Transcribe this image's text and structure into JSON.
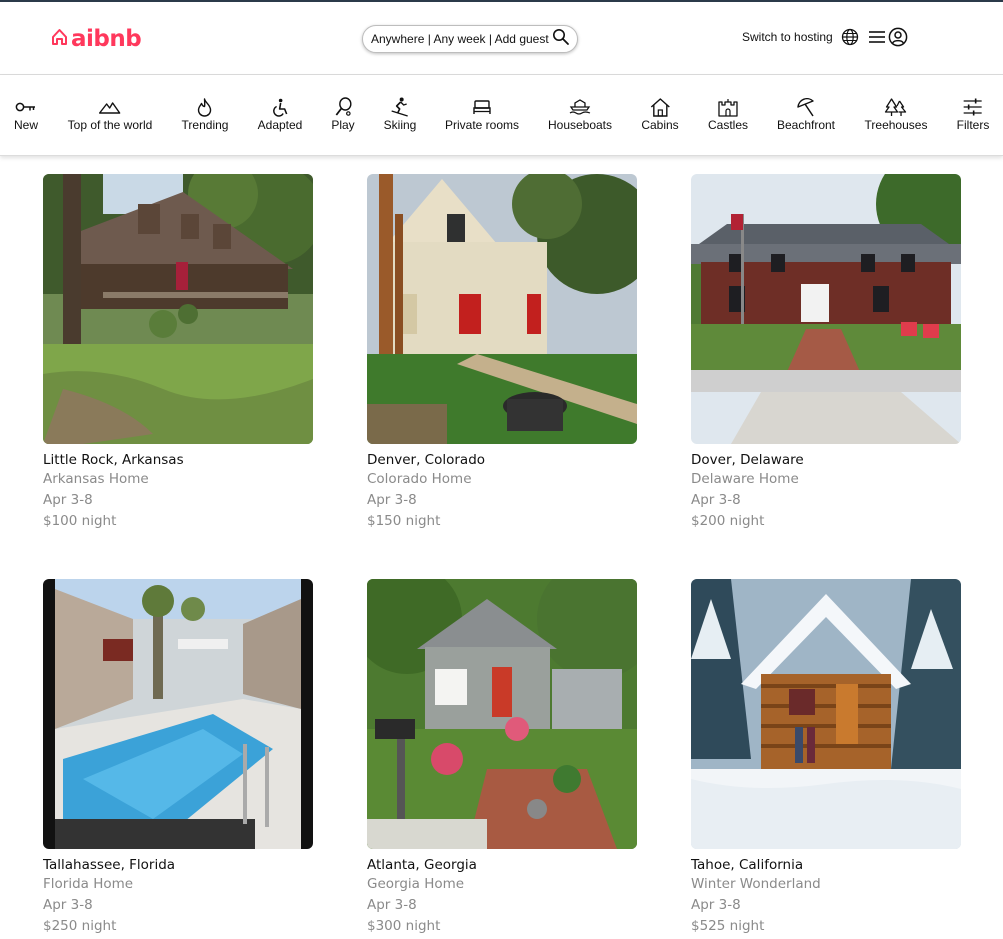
{
  "header": {
    "logo_text": "aibnb",
    "search_text": "Anywhere | Any week | Add guests",
    "host_link": "Switch to hosting",
    "brand_color": "#ff385c"
  },
  "categories": [
    {
      "label": "New",
      "icon": "key-icon"
    },
    {
      "label": "Top of the world",
      "icon": "mountain-icon"
    },
    {
      "label": "Trending",
      "icon": "flame-icon"
    },
    {
      "label": "Adapted",
      "icon": "wheelchair-icon"
    },
    {
      "label": "Play",
      "icon": "racket-icon"
    },
    {
      "label": "Skiing",
      "icon": "skier-icon"
    },
    {
      "label": "Private rooms",
      "icon": "bed-icon"
    },
    {
      "label": "Houseboats",
      "icon": "houseboat-icon"
    },
    {
      "label": "Cabins",
      "icon": "cabin-icon"
    },
    {
      "label": "Castles",
      "icon": "castle-icon"
    },
    {
      "label": "Beachfront",
      "icon": "umbrella-icon"
    },
    {
      "label": "Treehouses",
      "icon": "trees-icon"
    },
    {
      "label": "Filters",
      "icon": "sliders-icon"
    }
  ],
  "listings": [
    {
      "location": "Little Rock, Arkansas",
      "title": "Arkansas Home",
      "dates": "Apr 3-8",
      "price": "$100 night"
    },
    {
      "location": "Denver, Colorado",
      "title": "Colorado Home",
      "dates": "Apr 3-8",
      "price": "$150 night"
    },
    {
      "location": "Dover, Delaware",
      "title": "Delaware Home",
      "dates": "Apr 3-8",
      "price": "$200 night"
    },
    {
      "location": "Tallahassee, Florida",
      "title": "Florida Home",
      "dates": "Apr 3-8",
      "price": "$250 night"
    },
    {
      "location": "Atlanta, Georgia",
      "title": "Georgia Home",
      "dates": "Apr 3-8",
      "price": "$300 night"
    },
    {
      "location": "Tahoe, California",
      "title": "Winter Wonderland",
      "dates": "Apr 3-8",
      "price": "$525 night"
    }
  ]
}
